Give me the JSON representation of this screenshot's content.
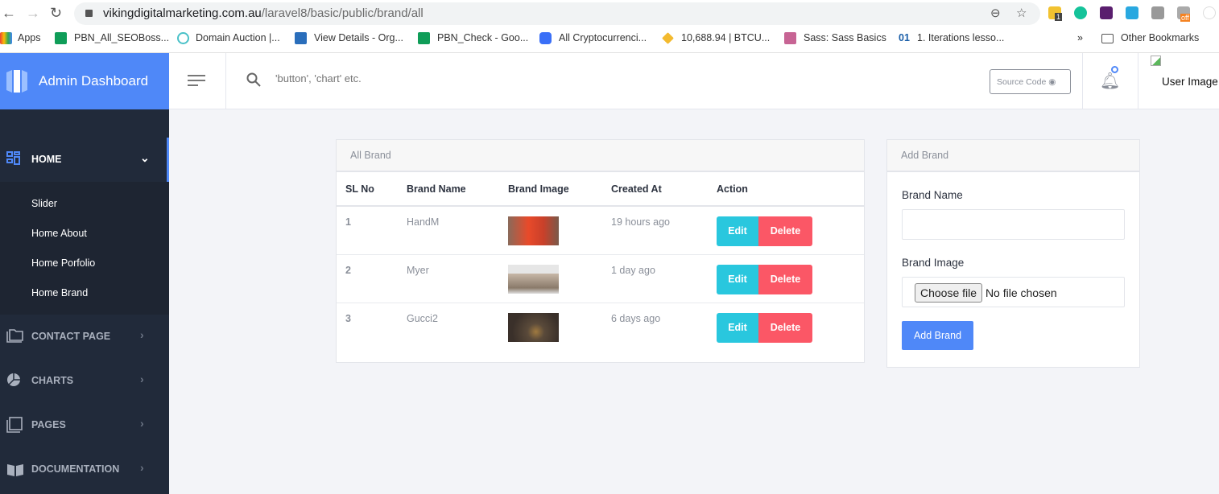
{
  "browser": {
    "url_host": "vikingdigitalmarketing.com.au",
    "url_path": "/laravel8/basic/public/brand/all",
    "ext_badge": "1",
    "ext_off": "off",
    "bookmarks": [
      "Apps",
      "PBN_All_SEOBoss...",
      "Domain Auction |...",
      "View Details - Org...",
      "PBN_Check - Goo...",
      "All Cryptocurrenci...",
      "10,688.94 | BTCU...",
      "Sass: Sass Basics",
      "1. Iterations lesso..."
    ],
    "more": "»",
    "other_bookmarks": "Other Bookmarks"
  },
  "header": {
    "brand": "Admin Dashboard",
    "search_placeholder": "'button', 'chart' etc.",
    "source_code": "Source Code",
    "user_image_alt": "User Image"
  },
  "sidebar": {
    "home": "HOME",
    "sub": [
      "Slider",
      "Home About",
      "Home Porfolio",
      "Home Brand"
    ],
    "items": [
      "CONTACT PAGE",
      "CHARTS",
      "PAGES",
      "DOCUMENTATION"
    ]
  },
  "all_brand": {
    "title": "All Brand",
    "columns": [
      "SL No",
      "Brand Name",
      "Brand Image",
      "Created At",
      "Action"
    ],
    "rows": [
      {
        "sl": "1",
        "name": "HandM",
        "created": "19 hours ago"
      },
      {
        "sl": "2",
        "name": "Myer",
        "created": "1 day ago"
      },
      {
        "sl": "3",
        "name": "Gucci2",
        "created": "6 days ago"
      }
    ],
    "edit": "Edit",
    "delete": "Delete"
  },
  "add_brand": {
    "title": "Add Brand",
    "name_label": "Brand Name",
    "name_value": "",
    "image_label": "Brand Image",
    "choose_file": "Choose file",
    "no_file": "No file chosen",
    "submit": "Add Brand"
  },
  "colors": {
    "accent": "#4f88f8",
    "sidebar": "#212a3a",
    "edit": "#29c7de",
    "delete": "#fb5766"
  }
}
